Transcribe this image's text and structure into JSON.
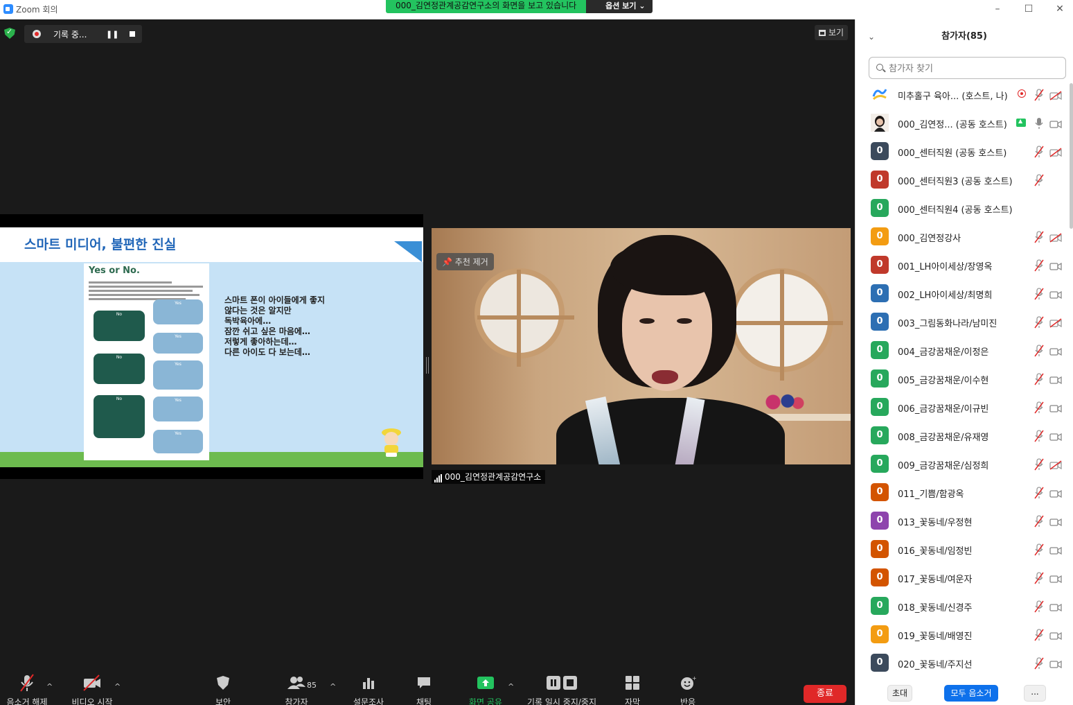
{
  "window": {
    "title": "Zoom 회의"
  },
  "share_banner": {
    "message": "000_김연정관계공감연구소의 화면을 보고 있습니다",
    "options_label": "옵션 보기"
  },
  "recording": {
    "status": "기록 중..."
  },
  "view_button": "보기",
  "slide": {
    "title": "스마트 미디어, 불편한 진실",
    "yes_or_no": "Yes or No.",
    "bubble_no": "No",
    "bubble_yes": "Yes",
    "lines": [
      "스마트 폰이 아이들에게 좋지",
      "않다는 것은 알지만",
      "",
      "독박육아에…",
      "잠깐 쉬고 싶은 마음에…",
      "저렇게 좋아하는데…",
      "다른 아이도 다 보는데…"
    ]
  },
  "video": {
    "pin_label": "추천 제거",
    "speaker_name": "000_김연정관계공감연구소"
  },
  "toolbar": {
    "mute_label": "음소거 해제",
    "video_label": "비디오 시작",
    "security_label": "보안",
    "participants_label": "참가자",
    "participants_count": "85",
    "poll_label": "설문조사",
    "chat_label": "채팅",
    "share_label": "화면 공유",
    "record_label": "기록 일시 중지/중지",
    "caption_label": "자막",
    "reactions_label": "반응",
    "end_label": "종료"
  },
  "panel": {
    "title": "참가자(85)",
    "search_placeholder": "참가자 찾기",
    "participants": [
      {
        "name": "미추홀구 육아...  (호스트, 나)",
        "avatar": "",
        "color": "#ffffff",
        "mic": "muted",
        "cam": "off",
        "badge": "rec"
      },
      {
        "name": "000_김연정...   (공동 호스트)",
        "avatar": "",
        "color": "#e8c4ac",
        "mic": "on",
        "cam": "on",
        "badge": "share"
      },
      {
        "name": "000_센터직원 (공동 호스트)",
        "avatar": "0",
        "color": "#3b4a5c",
        "mic": "muted",
        "cam": "off",
        "badge": ""
      },
      {
        "name": "000_센터직원3 (공동 호스트)",
        "avatar": "0",
        "color": "#c0392b",
        "mic": "muted",
        "cam": "none",
        "badge": ""
      },
      {
        "name": "000_센터직원4 (공동 호스트)",
        "avatar": "0",
        "color": "#27a85c",
        "mic": "none",
        "cam": "none",
        "badge": ""
      },
      {
        "name": "000_김연정강사",
        "avatar": "0",
        "color": "#f39c12",
        "mic": "muted",
        "cam": "off",
        "badge": ""
      },
      {
        "name": "001_LH아이세상/장영옥",
        "avatar": "0",
        "color": "#c0392b",
        "mic": "muted",
        "cam": "on",
        "badge": ""
      },
      {
        "name": "002_LH아이세상/최명희",
        "avatar": "0",
        "color": "#2d6fb3",
        "mic": "muted",
        "cam": "on",
        "badge": ""
      },
      {
        "name": "003_그림동화나라/남미진",
        "avatar": "0",
        "color": "#2d6fb3",
        "mic": "muted",
        "cam": "off",
        "badge": ""
      },
      {
        "name": "004_금강꿈채운/이정은",
        "avatar": "0",
        "color": "#27a85c",
        "mic": "muted",
        "cam": "on",
        "badge": ""
      },
      {
        "name": "005_금강꿈채운/이수현",
        "avatar": "0",
        "color": "#27a85c",
        "mic": "muted",
        "cam": "on",
        "badge": ""
      },
      {
        "name": "006_금강꿈채운/이규빈",
        "avatar": "0",
        "color": "#27a85c",
        "mic": "muted",
        "cam": "on",
        "badge": ""
      },
      {
        "name": "008_금강꿈채운/유재영",
        "avatar": "0",
        "color": "#27a85c",
        "mic": "muted",
        "cam": "on",
        "badge": ""
      },
      {
        "name": "009_금강꿈채운/심정희",
        "avatar": "0",
        "color": "#27a85c",
        "mic": "muted",
        "cam": "off",
        "badge": ""
      },
      {
        "name": "011_기쁨/함광옥",
        "avatar": "0",
        "color": "#d35400",
        "mic": "muted",
        "cam": "on",
        "badge": ""
      },
      {
        "name": "013_꽃동네/우정현",
        "avatar": "0",
        "color": "#8e44ad",
        "mic": "muted",
        "cam": "on",
        "badge": ""
      },
      {
        "name": "016_꽃동네/임정빈",
        "avatar": "0",
        "color": "#d35400",
        "mic": "muted",
        "cam": "on",
        "badge": ""
      },
      {
        "name": "017_꽃동네/여운자",
        "avatar": "0",
        "color": "#d35400",
        "mic": "muted",
        "cam": "on",
        "badge": ""
      },
      {
        "name": "018_꽃동네/신경주",
        "avatar": "0",
        "color": "#27a85c",
        "mic": "muted",
        "cam": "on",
        "badge": ""
      },
      {
        "name": "019_꽃동네/배영진",
        "avatar": "0",
        "color": "#f39c12",
        "mic": "muted",
        "cam": "on",
        "badge": ""
      },
      {
        "name": "020_꽃동네/주지선",
        "avatar": "0",
        "color": "#3b4a5c",
        "mic": "muted",
        "cam": "on",
        "badge": ""
      }
    ],
    "invite_label": "초대",
    "mute_all_label": "모두 음소거",
    "more_label": "..."
  }
}
